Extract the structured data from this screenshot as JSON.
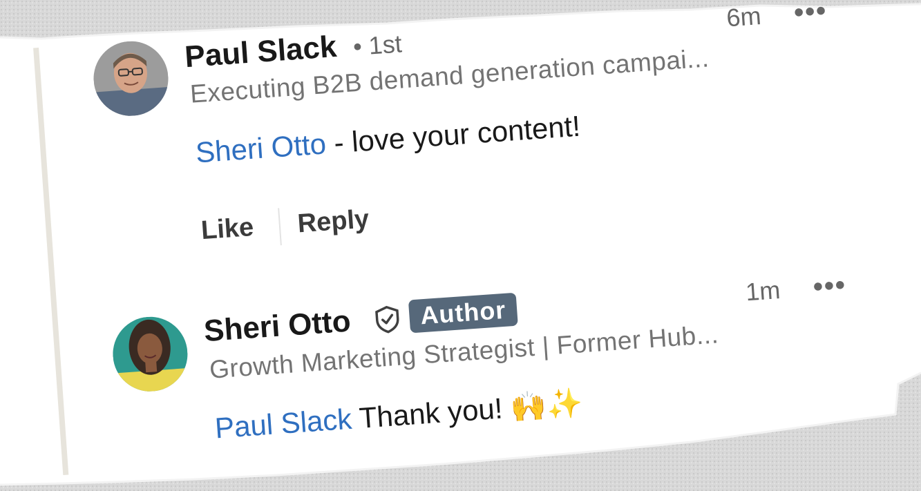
{
  "comments": [
    {
      "name": "Paul Slack",
      "degree": "• 1st",
      "headline": "Executing B2B demand generation campai...",
      "mention": "Sheri Otto",
      "text": " - love your content!",
      "time": "6m",
      "more": "•••",
      "actions": {
        "like": "Like",
        "reply": "Reply"
      }
    },
    {
      "name": "Sheri Otto",
      "badge": "Author",
      "headline": "Growth Marketing Strategist | Former Hub...",
      "mention": "Paul Slack",
      "text": " Thank you! 🙌✨",
      "time": "1m",
      "more": "•••"
    }
  ],
  "icons": {
    "verified": "verified-shield-icon",
    "more": "more-options-icon"
  },
  "colors": {
    "mention": "#2f6fc0",
    "badge_bg": "#56687a",
    "thread_line": "#e7e4dc"
  }
}
